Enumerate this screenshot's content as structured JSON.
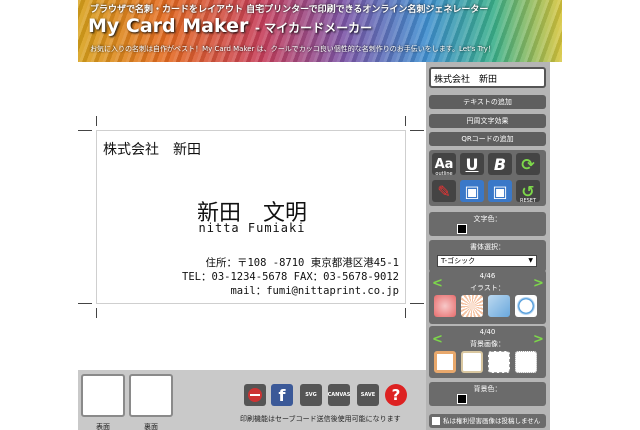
{
  "header": {
    "tagline": "ブラウザで名刺・カードをレイアウト 自宅プリンターで印刷できるオンライン名刺ジェネレーター",
    "title": "My Card Maker",
    "subtitle": "- マイカードメーカー",
    "description": "お気に入りの名刺は自作がベスト！My Card Maker は、クールでカッコ良い個性的な名刺作りのお手伝いをします。Let's Try！"
  },
  "card": {
    "company": "株式会社　新田",
    "name": "新田　文明",
    "romaji": "nitta Fumiaki",
    "address": "住所：〒108 -8710 東京都港区港45-1",
    "phone": "TEL：03-1234-5678 FAX：03-5678-9012",
    "mail": "mail：fumi@nittaprint.co.jp"
  },
  "bottom": {
    "front_label": "表面",
    "back_label": "裏面",
    "tools": [
      {
        "name": "delete-icon",
        "color": "#555"
      },
      {
        "name": "facebook-icon",
        "color": "#3b5998"
      },
      {
        "name": "print-svg-icon",
        "color": "#555",
        "text": "SVG"
      },
      {
        "name": "print-canvas-icon",
        "color": "#555",
        "text": "CANVAS"
      },
      {
        "name": "save-mail-icon",
        "color": "#555",
        "text": "SAVE"
      },
      {
        "name": "help-icon",
        "color": "#d22",
        "text": "?"
      }
    ],
    "note": "印刷機能はセーブコード送信後使用可能になります"
  },
  "panel": {
    "text_input_value": "株式会社　新田",
    "add_text": "テキストの追加",
    "circle_text": "円周文字効果",
    "add_qr": "QRコードの追加",
    "outline_label": "outline",
    "reset_label": "RESET",
    "text_color_label": "文字色：",
    "font_select_label": "書体選択：",
    "font_selected": "T-ゴシック",
    "illust_counter": "4/46",
    "illust_label": "イラスト：",
    "bg_counter": "4/40",
    "bg_label": "背景画像：",
    "bg_color_label": "背景色：",
    "checkbox_label": "私は権利侵害画像は投稿しません"
  },
  "colors": {
    "accent_green": "#7dd84a",
    "panel": "#b5b5b5",
    "section": "#6b6b6b"
  }
}
